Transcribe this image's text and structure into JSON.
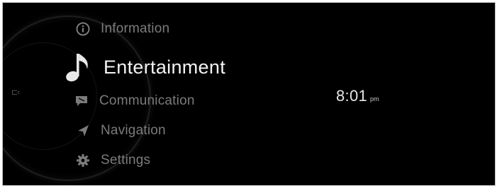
{
  "menu": {
    "items": [
      {
        "label": "Information",
        "icon": "info-icon"
      },
      {
        "label": "Entertainment",
        "icon": "music-note-icon",
        "selected": true
      },
      {
        "label": "Communication",
        "icon": "chat-bubble-icon"
      },
      {
        "label": "Navigation",
        "icon": "navigation-arrow-icon"
      },
      {
        "label": "Settings",
        "icon": "gear-icon"
      }
    ]
  },
  "clock": {
    "time": "8:01",
    "ampm": "pm"
  },
  "colors": {
    "background": "#000000",
    "selected_text": "#f3f3f3",
    "inactive_text": "#7b7b7b"
  }
}
